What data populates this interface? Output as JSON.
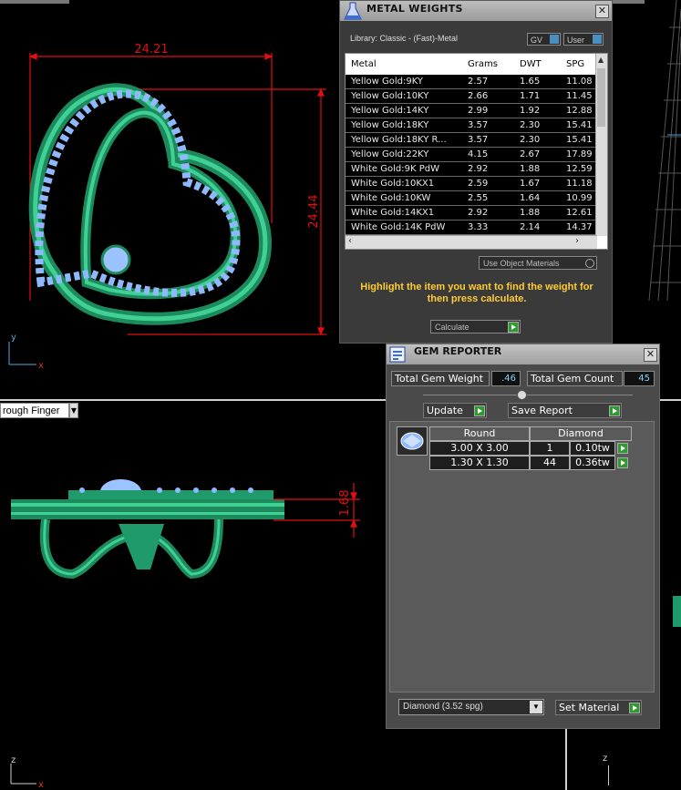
{
  "viewport": {
    "top_view": {
      "dim_width": "24.21",
      "dim_height": "24.44",
      "axis_y": "y",
      "axis_x": "x"
    },
    "front_view": {
      "dropdown_label": "rough Finger",
      "dim_thickness": "1.68",
      "axis_z": "z",
      "axis_x": "x"
    },
    "right_view": {
      "axis_z": "z"
    }
  },
  "metal_weights": {
    "title": "METAL WEIGHTS",
    "close": "✕",
    "library": "Library: Classic - (Fast)-Metal",
    "gv_label": "GV",
    "user_label": "User",
    "columns": [
      "Metal",
      "Grams",
      "DWT",
      "SPG"
    ],
    "rows": [
      [
        "Yellow Gold:9KY",
        "2.57",
        "1.65",
        "11.08"
      ],
      [
        "Yellow Gold:10KY",
        "2.66",
        "1.71",
        "11.45"
      ],
      [
        "Yellow Gold:14KY",
        "2.99",
        "1.92",
        "12.88"
      ],
      [
        "Yellow Gold:18KY",
        "3.57",
        "2.30",
        "15.41"
      ],
      [
        "Yellow Gold:18KY R...",
        "3.57",
        "2.30",
        "15.41"
      ],
      [
        "Yellow Gold:22KY",
        "4.15",
        "2.67",
        "17.89"
      ],
      [
        "White Gold:9K PdW",
        "2.92",
        "1.88",
        "12.59"
      ],
      [
        "White Gold:10KX1",
        "2.59",
        "1.67",
        "11.18"
      ],
      [
        "White Gold:10KW",
        "2.55",
        "1.64",
        "10.99"
      ],
      [
        "White Gold:14KX1",
        "2.92",
        "1.88",
        "12.61"
      ],
      [
        "White Gold:14K PdW",
        "3.33",
        "2.14",
        "14.37"
      ]
    ],
    "use_object_materials": "Use Object Materials",
    "hint": "Highlight the item you want to find the weight for then press calculate.",
    "calculate": "Calculate"
  },
  "gem_reporter": {
    "title": "GEM REPORTER",
    "close": "✕",
    "total_gem_weight_label": "Total Gem Weight",
    "total_gem_weight_value": ".46",
    "total_gem_count_label": "Total Gem Count",
    "total_gem_count_value": "45",
    "update": "Update",
    "save_report": "Save Report",
    "table_headers": [
      "Round",
      "Diamond"
    ],
    "gems": [
      {
        "size": "3.00 X 3.00",
        "count": "1",
        "weight": "0.10tw"
      },
      {
        "size": "1.30 X 1.30",
        "count": "44",
        "weight": "0.36tw"
      }
    ],
    "material_select": "Diamond    (3.52 spg)",
    "set_material": "Set Material"
  },
  "colors": {
    "dimension": "#e01010",
    "gold_model": "#1f9a6b",
    "gem": "#8fb8ff",
    "hint_text": "#ffcc33",
    "value_text": "#7fd4ff"
  }
}
